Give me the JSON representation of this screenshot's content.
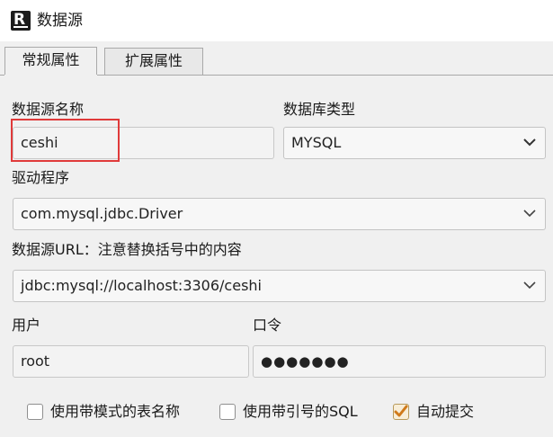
{
  "window": {
    "title": "数据源"
  },
  "tabs": [
    {
      "label": "常规属性"
    },
    {
      "label": "扩展属性"
    }
  ],
  "form": {
    "datasource_name": {
      "label": "数据源名称",
      "value": "ceshi"
    },
    "database_type": {
      "label": "数据库类型",
      "value": "MYSQL"
    },
    "driver": {
      "label": "驱动程序",
      "value": "com.mysql.jdbc.Driver"
    },
    "url": {
      "label": "数据源URL：注意替换括号中的内容",
      "value": "jdbc:mysql://localhost:3306/ceshi"
    },
    "user": {
      "label": "用户",
      "value": "root"
    },
    "password": {
      "label": "口令",
      "value": "●●●●●●●"
    }
  },
  "options": [
    {
      "label": "使用带模式的表名称",
      "checked": false
    },
    {
      "label": "使用带引号的SQL",
      "checked": false
    },
    {
      "label": "自动提交",
      "checked": true
    }
  ],
  "colors": {
    "highlight": "#e03a3a",
    "check_accent": "#d07a1a"
  }
}
